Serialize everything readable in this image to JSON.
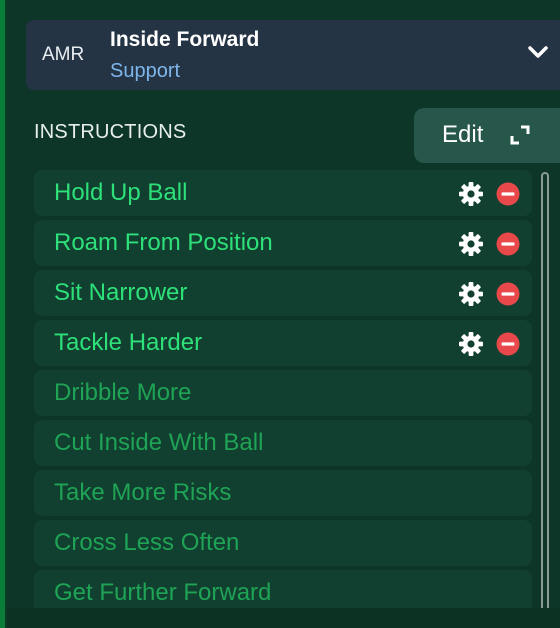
{
  "role": {
    "position": "AMR",
    "name": "Inside Forward",
    "duty": "Support"
  },
  "instructions": {
    "title": "INSTRUCTIONS",
    "edit_label": "Edit",
    "items": [
      {
        "label": "Hold Up Ball",
        "selected": true
      },
      {
        "label": "Roam From Position",
        "selected": true
      },
      {
        "label": "Sit Narrower",
        "selected": true
      },
      {
        "label": "Tackle Harder",
        "selected": true
      },
      {
        "label": "Dribble More",
        "selected": false
      },
      {
        "label": "Cut Inside With Ball",
        "selected": false
      },
      {
        "label": "Take More Risks",
        "selected": false
      },
      {
        "label": "Cross Less Often",
        "selected": false
      },
      {
        "label": "Get Further Forward",
        "selected": false
      }
    ]
  },
  "icons": {
    "chevron": "chevron-down-icon",
    "expand": "expand-icon",
    "gear": "gear-icon",
    "remove": "remove-icon"
  },
  "colors": {
    "background": "#0d3628",
    "role_bar": "#253445",
    "duty": "#7fb6ea",
    "active_text": "#2ee079",
    "inactive_text": "#1fa355",
    "remove_red": "#e8484a",
    "edit_button": "#27574a"
  }
}
